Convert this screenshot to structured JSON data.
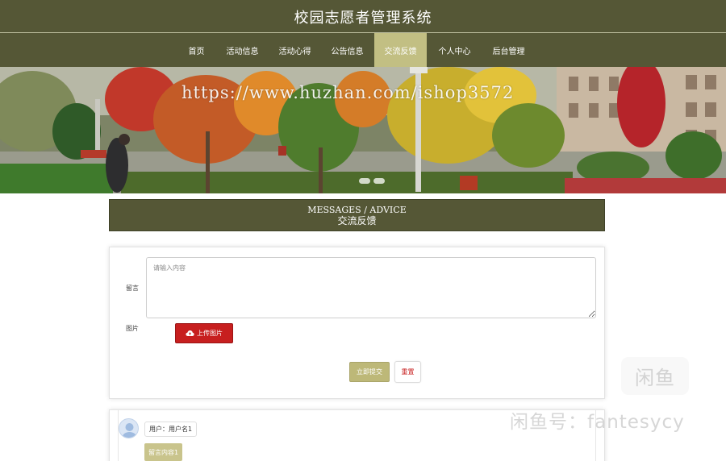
{
  "header": {
    "title": "校园志愿者管理系统"
  },
  "nav": {
    "items": [
      {
        "label": "首页"
      },
      {
        "label": "活动信息"
      },
      {
        "label": "活动心得"
      },
      {
        "label": "公告信息"
      },
      {
        "label": "交流反馈"
      },
      {
        "label": "个人中心"
      },
      {
        "label": "后台管理"
      }
    ],
    "active": "交流反馈"
  },
  "banner": {
    "watermark_text": "https://www.huzhan.com/ishop3572"
  },
  "section": {
    "title_en": "MESSAGES / ADVICE",
    "title_cn": "交流反馈"
  },
  "form": {
    "message_label": "留言",
    "message_placeholder": "请输入内容",
    "message_value": "",
    "image_label": "图片",
    "upload_label": "上传图片",
    "submit_label": "立即提交",
    "reset_label": "重置"
  },
  "comments": [
    {
      "user_text": "用户：用户名1",
      "content_text": "留言内容1"
    }
  ],
  "watermarks": {
    "badge_text": "闲鱼",
    "xianyu_text": "闲鱼号：fantesycy"
  },
  "colors": {
    "primary": "#555736",
    "active_nav": "#c2bf83",
    "accent_red": "#c71f1f",
    "submit": "#bdb878"
  },
  "icons": {
    "upload": "cloud-upload-icon",
    "avatar": "user-avatar-icon"
  }
}
